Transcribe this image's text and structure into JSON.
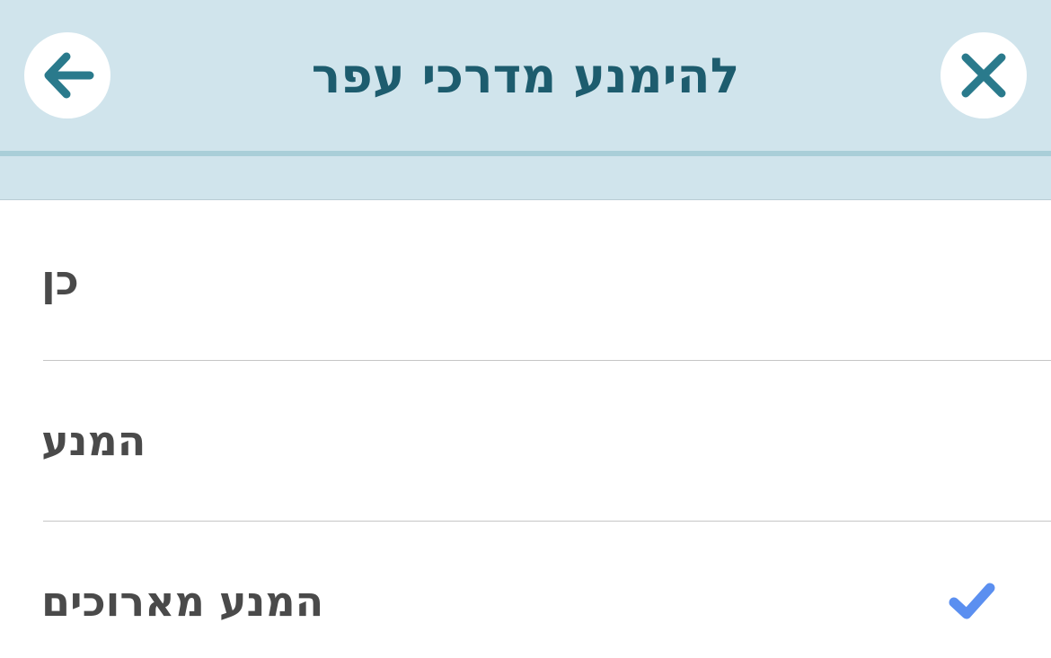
{
  "header": {
    "title": "להימנע מדרכי עפר",
    "back_icon": "arrow-left-icon",
    "close_icon": "close-icon"
  },
  "options": [
    {
      "label": "כן",
      "selected": false
    },
    {
      "label": "המנע",
      "selected": false
    },
    {
      "label": "המנע מארוכים",
      "selected": true
    }
  ],
  "colors": {
    "header_bg": "#d0e4ec",
    "title": "#1d5c6e",
    "icon": "#2a7a8c",
    "check": "#5b8ff0",
    "label": "#4a4a4a"
  }
}
